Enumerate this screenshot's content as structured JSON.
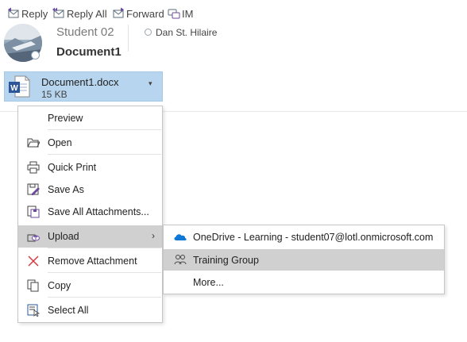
{
  "toolbar": {
    "reply": "Reply",
    "reply_all": "Reply All",
    "forward": "Forward",
    "im": "IM"
  },
  "message": {
    "sender": "Student 02",
    "recipient": "Dan St. Hilaire",
    "subject": "Document1"
  },
  "attachment": {
    "name": "Document1.docx",
    "size": "15 KB"
  },
  "context_menu": {
    "preview": "Preview",
    "open": "Open",
    "quick_print": "Quick Print",
    "save_as": "Save As",
    "save_all": "Save All Attachments...",
    "upload": "Upload",
    "remove": "Remove Attachment",
    "copy": "Copy",
    "select_all": "Select All"
  },
  "upload_submenu": {
    "onedrive": "OneDrive - Learning - student07@lotl.onmicrosoft.com",
    "training_group": "Training Group",
    "more": "More..."
  },
  "colors": {
    "attachment_bg": "#b7d5ee",
    "menu_highlight": "#d0d0d0",
    "word_blue": "#2b579a",
    "onedrive_blue": "#0f78d4",
    "remove_red": "#d13438"
  }
}
